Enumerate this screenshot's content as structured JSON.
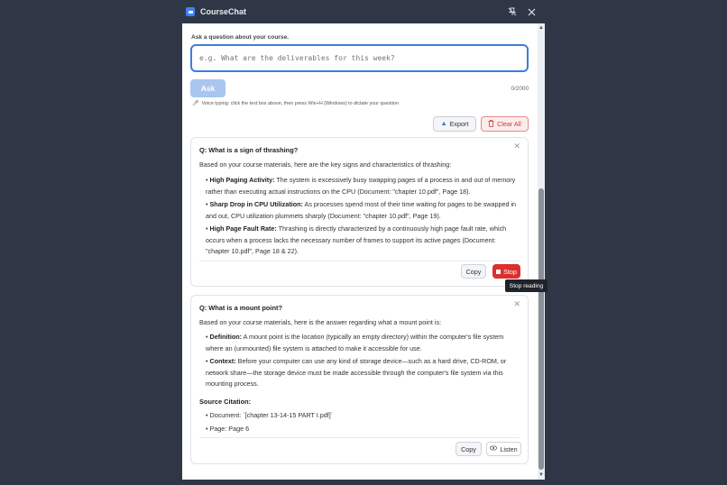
{
  "window": {
    "title": "CourseChat",
    "pin_icon": "pin-off-icon",
    "close_icon": "close-icon"
  },
  "ask": {
    "label": "Ask a question about your course.",
    "placeholder": "e.g. What are the deliverables for this week?",
    "button": "Ask",
    "char_count": "0/2000",
    "voice_hint": "Voice typing: click the text box above, then press Win+H (Windows) to dictate your question"
  },
  "toolbar": {
    "export_label": "Export",
    "clear_label": "Clear All"
  },
  "cards": [
    {
      "question": "Q: What is a sign of thrashing?",
      "intro": "Based on your course materials, here are the key signs and characteristics of thrashing:",
      "bullets": [
        {
          "term": "High Paging Activity:",
          "text": " The system is excessively busy swapping pages of a process in and out of memory rather than executing actual instructions on the CPU (Document: \"chapter 10.pdf\", Page 18)."
        },
        {
          "term": "Sharp Drop in CPU Utilization:",
          "text": " As processes spend most of their time waiting for pages to be swapped in and out, CPU utilization plummets sharply (Document: \"chapter 10.pdf\", Page 19)."
        },
        {
          "term": "High Page Fault Rate:",
          "text": " Thrashing is directly characterized by a continuously high page fault rate, which occurs when a process lacks the necessary number of frames to support its active pages (Document: \"chapter 10.pdf\", Page 18 & 22)."
        }
      ],
      "copy_label": "Copy",
      "stop_label": "Stop"
    },
    {
      "question": "Q: What is a mount point?",
      "intro": "Based on your course materials, here is the answer regarding what a mount point is:",
      "bullets": [
        {
          "term": "Definition:",
          "text": " A mount point is the location (typically an empty directory) within the computer's file system where an (unmounted) file system is attached to make it accessible for use."
        },
        {
          "term": "Context:",
          "text": " Before your computer can use any kind of storage device—such as a hard drive, CD-ROM, or network share—the storage device must be made accessible through the computer's file system via this mounting process."
        }
      ],
      "source_title": "Source Citation:",
      "sources": [
        "• Document: `[chapter 13-14-15 PART I.pdf]`",
        "• Page: Page 6"
      ],
      "copy_label": "Copy",
      "listen_label": "Listen"
    }
  ],
  "tooltip": "Stop reading"
}
